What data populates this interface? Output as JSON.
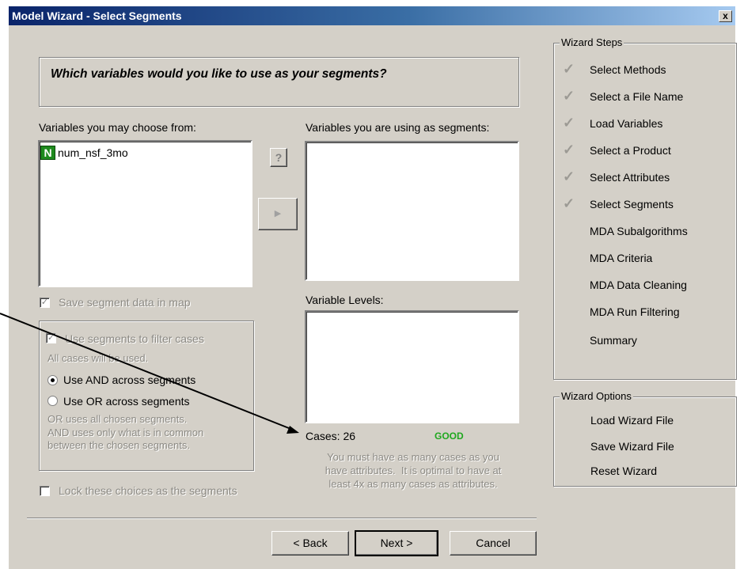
{
  "window": {
    "title": "Model Wizard - Select Segments",
    "close_label": "x"
  },
  "question": "Which variables would you like to use as your segments?",
  "available": {
    "label": "Variables you may choose from:",
    "items": [
      {
        "badge": "N",
        "name": "num_nsf_3mo"
      }
    ]
  },
  "using": {
    "label": "Variables you are using as segments:"
  },
  "levels": {
    "label": "Variable Levels:"
  },
  "help_button": "?",
  "add_button": "▶",
  "options": {
    "save_map": "Save segment data in map",
    "filter_cases": "Use segments to filter cases",
    "all_cases": "All cases will be used.",
    "use_and": "Use AND across segments",
    "use_or": "Use OR across segments",
    "explain": "OR uses all chosen segments.\nAND uses only what is in common\nbetween the chosen segments.",
    "lock": "Lock these choices as the segments"
  },
  "cases": {
    "label": "Cases: 26",
    "status": "GOOD",
    "status_color": "#1fa81f",
    "note": "You must have as many cases as you\nhave attributes.  It is optimal to have at\nleast 4x as many cases as attributes."
  },
  "wizard_steps": {
    "title": "Wizard Steps",
    "items": [
      {
        "label": "Select Methods",
        "done": true
      },
      {
        "label": "Select a File Name",
        "done": true
      },
      {
        "label": "Load Variables",
        "done": true
      },
      {
        "label": "Select a Product",
        "done": true
      },
      {
        "label": "Select Attributes",
        "done": true
      },
      {
        "label": "Select Segments",
        "done": true
      },
      {
        "label": "MDA Subalgorithms",
        "done": false
      },
      {
        "label": "MDA Criteria",
        "done": false
      },
      {
        "label": "MDA Data Cleaning",
        "done": false
      },
      {
        "label": "MDA Run Filtering",
        "done": false
      },
      {
        "label": "Summary",
        "done": false
      }
    ]
  },
  "wizard_options": {
    "title": "Wizard Options",
    "items": [
      "Load Wizard File",
      "Save Wizard File",
      "Reset Wizard"
    ]
  },
  "buttons": {
    "back": "< Back",
    "next": "Next >",
    "cancel": "Cancel"
  }
}
